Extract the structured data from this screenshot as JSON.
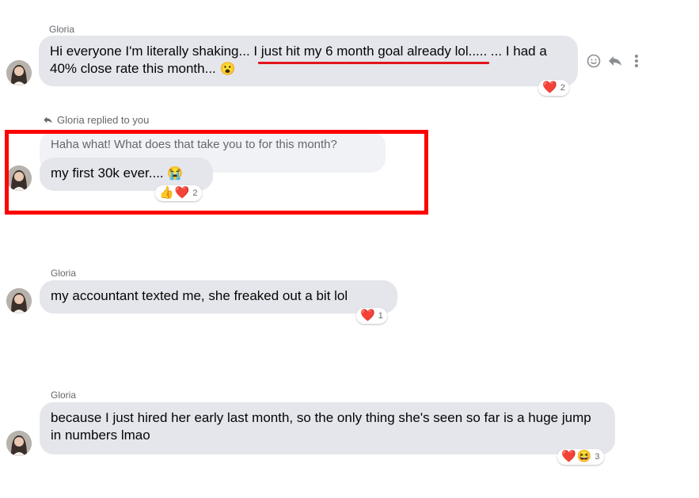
{
  "messages": [
    {
      "sender": "Gloria",
      "text_before": "Hi everyone I'm literally shaking... ",
      "text_underlined": "I just hit my 6 month goal already lol",
      "text_after": "..... ... I had a 40% close rate this month... ",
      "emoji": "😮",
      "reaction": {
        "emojis": [
          "❤️"
        ],
        "count": "2"
      }
    },
    {
      "reply_note": "Gloria replied to you",
      "quoted_text": "Haha what! What does that take you to for this month?",
      "text": "my first 30k ever.... ",
      "emoji": "😭",
      "reaction": {
        "emojis": [
          "👍",
          "❤️"
        ],
        "count": "2"
      }
    },
    {
      "sender": "Gloria",
      "text": "my accountant texted me, she freaked out a bit lol",
      "reaction": {
        "emojis": [
          "❤️"
        ],
        "count": "1"
      }
    },
    {
      "sender": "Gloria",
      "text": "because I just hired her early last month, so the only thing she's seen so far is a huge jump in numbers lmao",
      "reaction": {
        "emojis": [
          "❤️",
          "😆"
        ],
        "count": "3"
      }
    }
  ],
  "actions": {
    "react_icon": "smiley-icon",
    "reply_icon": "reply-arrow-icon",
    "more_icon": "more-vertical-icon"
  },
  "colors": {
    "bubble": "#e4e6eb",
    "quoted_bubble": "#f0f2f5",
    "annotation_red": "#ff0000",
    "underline_red": "#e3141b",
    "secondary_text": "#65676b"
  }
}
